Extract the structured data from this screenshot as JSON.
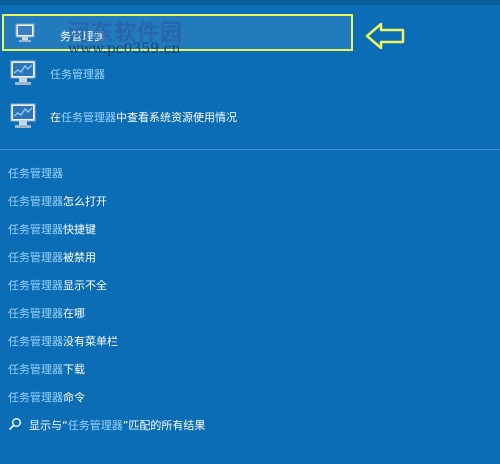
{
  "search": {
    "query_text": "务管理器"
  },
  "watermark": {
    "title": "河东软件园",
    "url": "www.pc0359.cn"
  },
  "best_matches": [
    {
      "prefix": "",
      "match": "任务管理器",
      "suffix": ""
    },
    {
      "prefix": "在",
      "match": "任务管理器",
      "suffix": "中查看系统资源使用情况"
    }
  ],
  "suggestions": [
    {
      "match": "任务管理器",
      "suffix": ""
    },
    {
      "match": "任务管理器",
      "suffix": "怎么打开"
    },
    {
      "match": "任务管理器",
      "suffix": "快捷键"
    },
    {
      "match": "任务管理器",
      "suffix": "被禁用"
    },
    {
      "match": "任务管理器",
      "suffix": "显示不全"
    },
    {
      "match": "任务管理器",
      "suffix": "在哪"
    },
    {
      "match": "任务管理器",
      "suffix": "没有菜单栏"
    },
    {
      "match": "任务管理器",
      "suffix": "下载"
    },
    {
      "match": "任务管理器",
      "suffix": "命令"
    }
  ],
  "footer": {
    "prefix": "显示与“",
    "match": "任务管理器",
    "suffix": "”匹配的所有结果"
  },
  "colors": {
    "background": "#0a6db5",
    "highlight_border": "#e7f55e",
    "match_text": "#9bd3ff"
  }
}
